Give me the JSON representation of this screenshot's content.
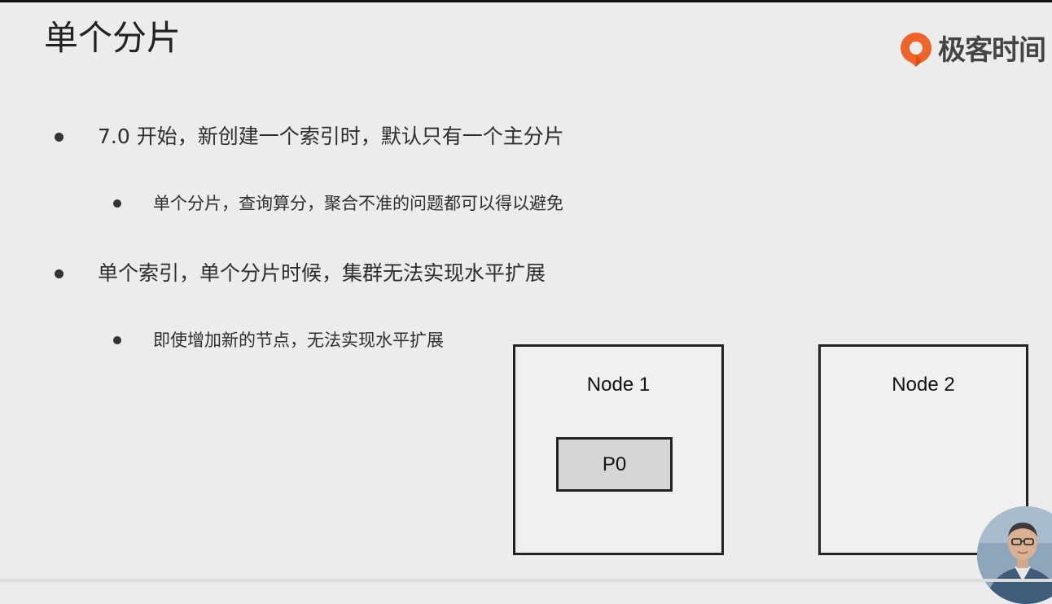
{
  "slide": {
    "title": "单个分片"
  },
  "brand": {
    "logo_text": "极客时间",
    "accent_color": "#f0642b"
  },
  "bullets": [
    {
      "level": 1,
      "text": "7.0 开始，新创建一个索引时，默认只有一个主分片"
    },
    {
      "level": 2,
      "text": "单个分片，查询算分，聚合不准的问题都可以得以避免"
    },
    {
      "level": 1,
      "text": "单个索引，单个分片时候，集群无法实现水平扩展"
    },
    {
      "level": 2,
      "text": "即使增加新的节点，无法实现水平扩展"
    }
  ],
  "diagram": {
    "nodes": [
      {
        "label": "Node 1",
        "shards": [
          "P0"
        ]
      },
      {
        "label": "Node 2",
        "shards": []
      }
    ]
  },
  "presenter": {
    "icon": "presenter-video-thumbnail"
  }
}
